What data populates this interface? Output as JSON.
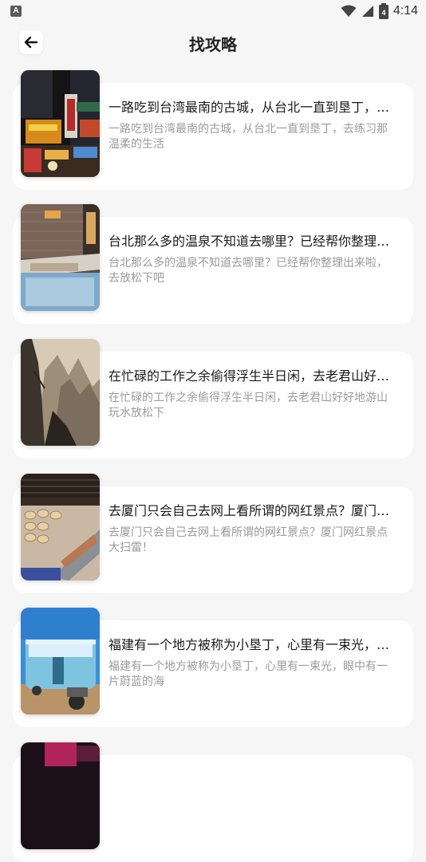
{
  "status_bar": {
    "indicator": "A",
    "time": "4:14",
    "battery_glyph": "4",
    "icons": [
      "wifi-icon",
      "signal-icon",
      "battery-icon"
    ]
  },
  "header": {
    "title": "找攻略",
    "back_icon": "arrow-left-icon"
  },
  "articles": [
    {
      "title": "一路吃到台湾最南的古城，从台北一直到垦丁，去练习那温柔的生活",
      "desc": "一路吃到台湾最南的古城，从台北一直到垦丁，去练习那温柔的生活"
    },
    {
      "title": "台北那么多的温泉不知道去哪里？已经帮你整理出来啦，去放松下吧",
      "desc": "台北那么多的温泉不知道去哪里？已经帮你整理出来啦，去放松下吧"
    },
    {
      "title": "在忙碌的工作之余偷得浮生半日闲，去老君山好好地游山玩水放松下",
      "desc": "在忙碌的工作之余偷得浮生半日闲，去老君山好好地游山玩水放松下"
    },
    {
      "title": "去厦门只会自己去网上看所谓的网红景点？厦门网红景点大扫雷！",
      "desc": "去厦门只会自己去网上看所谓的网红景点？厦门网红景点大扫雷！"
    },
    {
      "title": "福建有一个地方被称为小垦丁，心里有一束光，眼中有一片蔚蓝的海",
      "desc": "福建有一个地方被称为小垦丁，心里有一束光，眼中有一片蔚蓝的海"
    }
  ]
}
